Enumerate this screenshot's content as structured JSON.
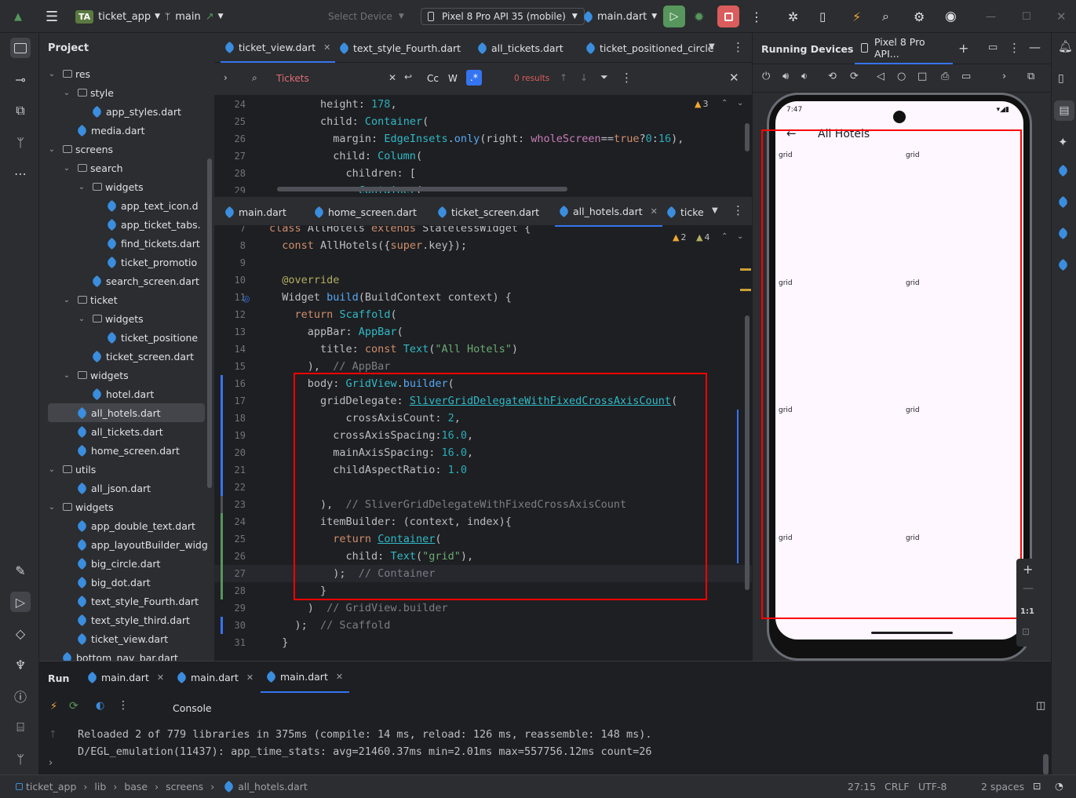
{
  "topbar": {
    "project_badge": "TA",
    "project_name": "ticket_app",
    "branch": "main",
    "select_device": "Select Device",
    "device": "Pixel 8 Pro API 35 (mobile)",
    "run_config": "main.dart"
  },
  "project_panel": {
    "title": "Project",
    "tree": [
      {
        "label": "res",
        "type": "folder",
        "depth": 2,
        "expanded": true
      },
      {
        "label": "style",
        "type": "folder",
        "depth": 3,
        "expanded": true
      },
      {
        "label": "app_styles.dart",
        "type": "dart",
        "depth": 4
      },
      {
        "label": "media.dart",
        "type": "dart",
        "depth": 3
      },
      {
        "label": "screens",
        "type": "folder",
        "depth": 2,
        "expanded": true
      },
      {
        "label": "search",
        "type": "folder",
        "depth": 3,
        "expanded": true
      },
      {
        "label": "widgets",
        "type": "folder",
        "depth": 4,
        "expanded": true
      },
      {
        "label": "app_text_icon.d",
        "type": "dart",
        "depth": 5
      },
      {
        "label": "app_ticket_tabs.",
        "type": "dart",
        "depth": 5
      },
      {
        "label": "find_tickets.dart",
        "type": "dart",
        "depth": 5
      },
      {
        "label": "ticket_promotio",
        "type": "dart",
        "depth": 5
      },
      {
        "label": "search_screen.dart",
        "type": "dart",
        "depth": 4
      },
      {
        "label": "ticket",
        "type": "folder",
        "depth": 3,
        "expanded": true
      },
      {
        "label": "widgets",
        "type": "folder",
        "depth": 4,
        "expanded": true
      },
      {
        "label": "ticket_positione",
        "type": "dart",
        "depth": 5
      },
      {
        "label": "ticket_screen.dart",
        "type": "dart",
        "depth": 4
      },
      {
        "label": "widgets",
        "type": "folder",
        "depth": 3,
        "expanded": true
      },
      {
        "label": "hotel.dart",
        "type": "dart",
        "depth": 4
      },
      {
        "label": "all_hotels.dart",
        "type": "dart",
        "depth": 3,
        "selected": true
      },
      {
        "label": "all_tickets.dart",
        "type": "dart",
        "depth": 3
      },
      {
        "label": "home_screen.dart",
        "type": "dart",
        "depth": 3
      },
      {
        "label": "utils",
        "type": "folder",
        "depth": 2,
        "expanded": true
      },
      {
        "label": "all_json.dart",
        "type": "dart",
        "depth": 3
      },
      {
        "label": "widgets",
        "type": "folder",
        "depth": 2,
        "expanded": true
      },
      {
        "label": "app_double_text.dart",
        "type": "dart",
        "depth": 3
      },
      {
        "label": "app_layoutBuilder_widg",
        "type": "dart",
        "depth": 3
      },
      {
        "label": "big_circle.dart",
        "type": "dart",
        "depth": 3
      },
      {
        "label": "big_dot.dart",
        "type": "dart",
        "depth": 3
      },
      {
        "label": "text_style_Fourth.dart",
        "type": "dart",
        "depth": 3
      },
      {
        "label": "text_style_third.dart",
        "type": "dart",
        "depth": 3
      },
      {
        "label": "ticket_view.dart",
        "type": "dart",
        "depth": 3
      },
      {
        "label": "bottom_nav_bar.dart",
        "type": "dart",
        "depth": 2
      }
    ]
  },
  "editor_top": {
    "tabs": [
      "ticket_view.dart",
      "text_style_Fourth.dart",
      "all_tickets.dart",
      "ticket_positioned_circle"
    ],
    "search": {
      "query": "Tickets",
      "results": "0 results",
      "case": "Cc",
      "word": "W",
      "regex": ".*"
    },
    "warnings": "3",
    "lines": [
      {
        "n": "24",
        "html": "        height: <span class='n'>178</span>,"
      },
      {
        "n": "25",
        "html": "        child: <span class='t'>Container</span>("
      },
      {
        "n": "26",
        "html": "          margin: <span class='t'>EdgeInsets</span>.<span class='f'>only</span>(right: <span class='p'>wholeScreen</span>==<span class='k'>true</span>?<span class='n'>0</span>:<span class='n'>16</span>),"
      },
      {
        "n": "27",
        "html": "          child: <span class='t'>Column</span>("
      },
      {
        "n": "28",
        "html": "            children: ["
      },
      {
        "n": "29",
        "html": "              <span class='t'>Container</span>("
      }
    ]
  },
  "editor_bottom": {
    "tabs": [
      "main.dart",
      "home_screen.dart",
      "ticket_screen.dart",
      "all_hotels.dart",
      "ticke"
    ],
    "warnings": "2",
    "weak": "4",
    "lines": [
      {
        "n": "7",
        "html": "<span class='k'>class</span> AllHotels <span class='k'>extends</span> StatelessWidget {"
      },
      {
        "n": "8",
        "html": "  <span class='k'>const</span> AllHotels({<span class='k'>super</span>.key});"
      },
      {
        "n": "9",
        "html": ""
      },
      {
        "n": "10",
        "html": "  <span class='a'>@override</span>"
      },
      {
        "n": "11",
        "html": "  Widget <span class='f'>build</span>(BuildContext context) {"
      },
      {
        "n": "12",
        "html": "    <span class='k'>return</span> <span class='t'>Scaffold</span>("
      },
      {
        "n": "13",
        "html": "      appBar: <span class='t'>AppBar</span>("
      },
      {
        "n": "14",
        "html": "        title: <span class='k'>const</span> <span class='t'>Text</span>(<span class='s'>\"All Hotels\"</span>)"
      },
      {
        "n": "15",
        "html": "      ),  <span class='c'>// AppBar</span>"
      },
      {
        "n": "16",
        "html": "      body: <span class='t'>GridView</span>.<span class='f'>builder</span>("
      },
      {
        "n": "17",
        "html": "        gridDelegate: <span class='t' style='text-decoration:underline'>SliverGridDelegateWithFixedCrossAxisCount</span>("
      },
      {
        "n": "18",
        "html": "            crossAxisCount: <span class='n'>2</span>,"
      },
      {
        "n": "19",
        "html": "          crossAxisSpacing:<span class='n'>16.0</span>,"
      },
      {
        "n": "20",
        "html": "          mainAxisSpacing: <span class='n'>16.0</span>,"
      },
      {
        "n": "21",
        "html": "          childAspectRatio: <span class='n'>1.0</span>"
      },
      {
        "n": "22",
        "html": ""
      },
      {
        "n": "23",
        "html": "        ),  <span class='c'>// SliverGridDelegateWithFixedCrossAxisCount</span>"
      },
      {
        "n": "24",
        "html": "        itemBuilder: (context, index){"
      },
      {
        "n": "25",
        "html": "          <span class='k'>return</span> <span class='t' style='text-decoration:underline'>Container</span>("
      },
      {
        "n": "26",
        "html": "            child: <span class='t'>Text</span>(<span class='s'>\"grid\"</span>),"
      },
      {
        "n": "27",
        "html": "          );  <span class='c'>// Container</span>"
      },
      {
        "n": "28",
        "html": "        }"
      },
      {
        "n": "29",
        "html": "      )  <span class='c'>// GridView.builder</span>"
      },
      {
        "n": "30",
        "html": "    );  <span class='c'>// Scaffold</span>"
      },
      {
        "n": "31",
        "html": "  }"
      }
    ]
  },
  "device_panel": {
    "title": "Running Devices",
    "device_tab": "Pixel 8 Pro API...",
    "status_time": "7:47",
    "app_title": "All Hotels",
    "grid_items": [
      "grid",
      "grid",
      "grid",
      "grid",
      "grid",
      "grid",
      "grid",
      "grid"
    ],
    "zoom_label": "1:1"
  },
  "run_panel": {
    "title": "Run",
    "tabs": [
      "main.dart",
      "main.dart",
      "main.dart"
    ],
    "console_label": "Console",
    "console_lines": [
      "Reloaded 2 of 779 libraries in 375ms (compile: 14 ms, reload: 126 ms, reassemble: 148 ms).",
      "D/EGL_emulation(11437): app_time_stats: avg=21460.37ms min=2.01ms max=557756.12ms count=26"
    ]
  },
  "status_bar": {
    "breadcrumb": [
      "ticket_app",
      "lib",
      "base",
      "screens",
      "all_hotels.dart"
    ],
    "position": "27:15",
    "line_sep": "CRLF",
    "encoding": "UTF-8",
    "indent": "2 spaces"
  },
  "colors": {
    "highlight_box": "#ff0000",
    "accent": "#3574f0",
    "run_green": "#57965c",
    "debug_red": "#db5c5c"
  }
}
